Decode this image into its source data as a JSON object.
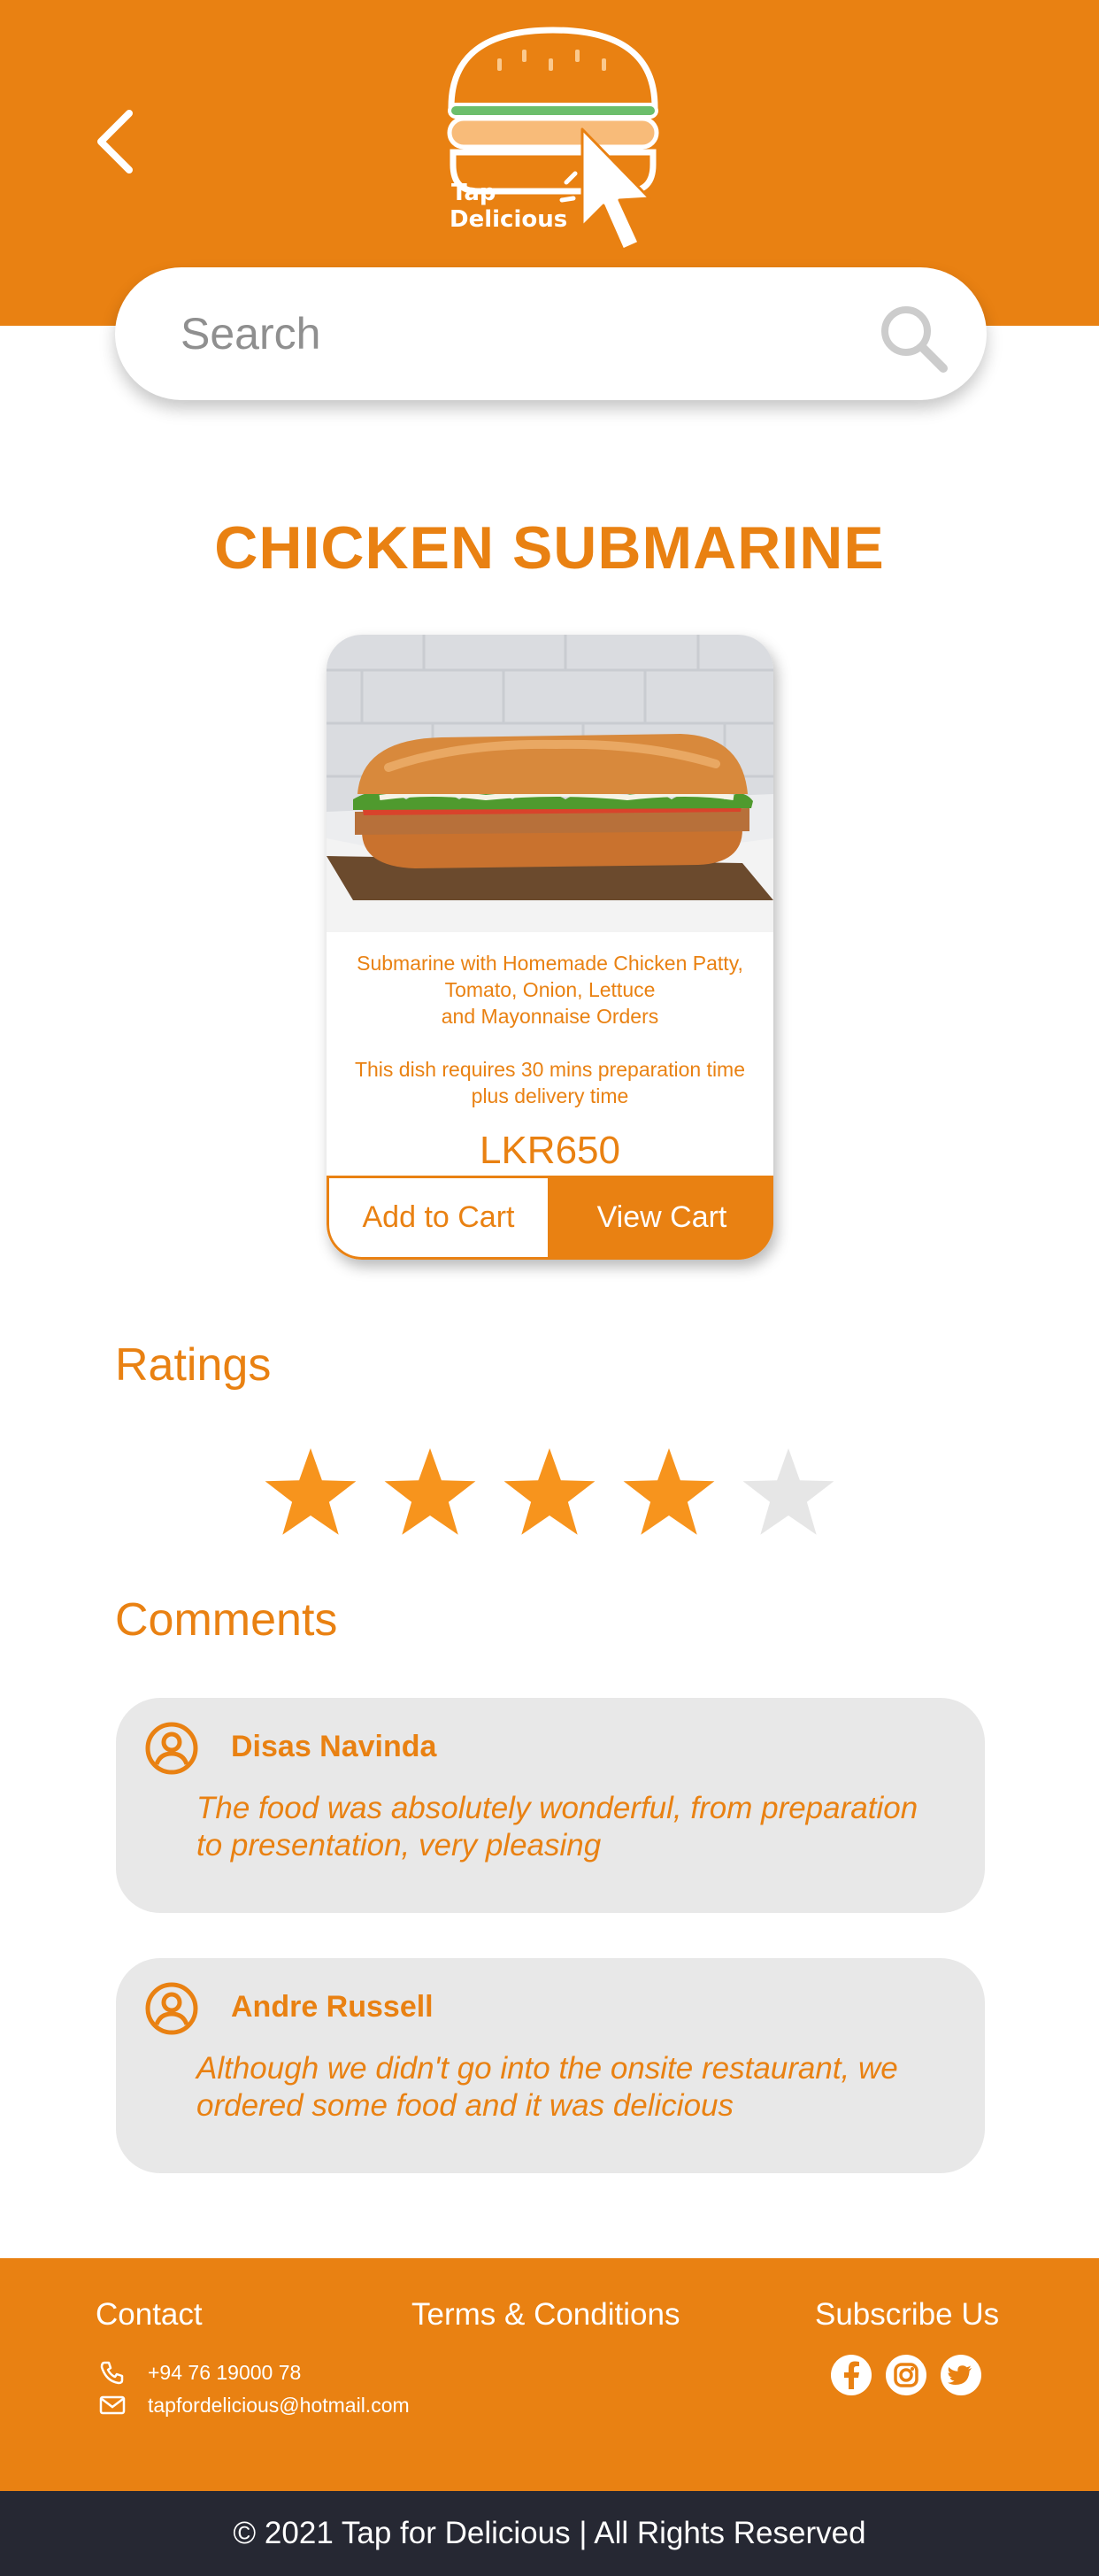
{
  "colors": {
    "brand": "#E98112",
    "star_filled": "#F7941D",
    "star_empty": "#E6E6E6",
    "comment_bg": "#E8E8E8",
    "footer_dark": "#262833"
  },
  "header": {
    "logo_line1": "Tap",
    "logo_line2": "Delicious"
  },
  "search": {
    "placeholder": "Search"
  },
  "product": {
    "title": "CHICKEN SUBMARINE",
    "description_lines": [
      "Submarine with Homemade Chicken Patty,",
      "Tomato, Onion, Lettuce",
      "and Mayonnaise Orders"
    ],
    "prep_lines": [
      "This dish requires 30 mins preparation time",
      "plus delivery time"
    ],
    "price": "LKR650",
    "add_to_cart_label": "Add to Cart",
    "view_cart_label": "View Cart"
  },
  "ratings": {
    "title": "Ratings",
    "stars_filled": 4,
    "stars_total": 5
  },
  "comments": {
    "title": "Comments",
    "items": [
      {
        "name": "Disas Navinda",
        "lines": [
          "The food was absolutely wonderful, from preparation",
          "to presentation, very pleasing"
        ]
      },
      {
        "name": "Andre Russell",
        "lines": [
          "Although we didn't go into the onsite restaurant, we",
          "ordered some food and it was delicious"
        ]
      }
    ]
  },
  "footer": {
    "contact_title": "Contact",
    "terms_label": "Terms & Conditions",
    "subscribe_title": "Subscribe Us",
    "phone": "+94 76 19000 78",
    "email": "tapfordelicious@hotmail.com",
    "socials": [
      "facebook-icon",
      "instagram-icon",
      "twitter-icon"
    ],
    "copyright": "© 2021 Tap for Delicious | All Rights Reserved"
  }
}
